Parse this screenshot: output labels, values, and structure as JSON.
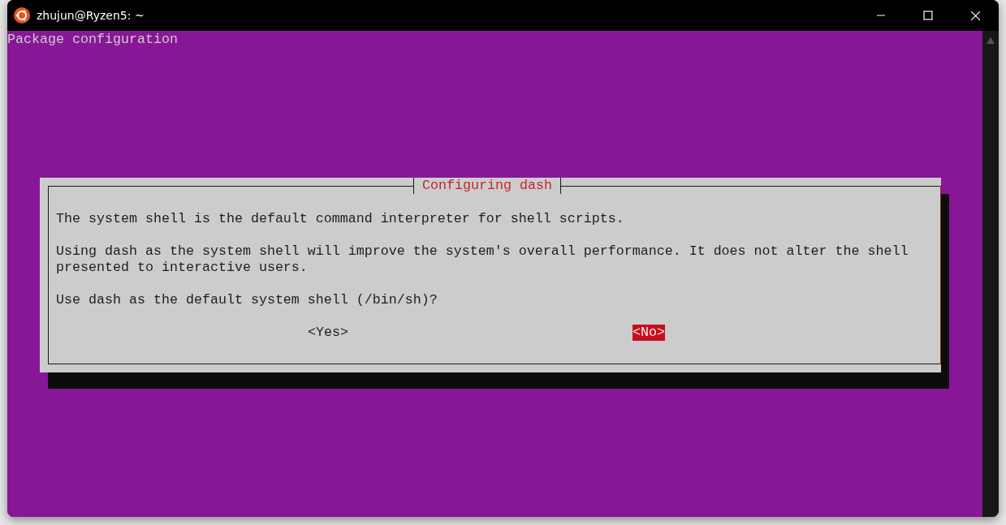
{
  "window": {
    "title": "zhujun@Ryzen5: ~"
  },
  "terminal": {
    "header": "Package configuration"
  },
  "dialog": {
    "title": "Configuring dash",
    "paragraphs": [
      "The system shell is the default command interpreter for shell scripts.",
      "Using dash as the system shell will improve the system's overall performance. It does not alter the shell presented to interactive users.",
      "Use dash as the default system shell (/bin/sh)?"
    ],
    "buttons": [
      {
        "label": "<Yes>",
        "selected": false
      },
      {
        "label": "<No>",
        "selected": true
      }
    ]
  }
}
